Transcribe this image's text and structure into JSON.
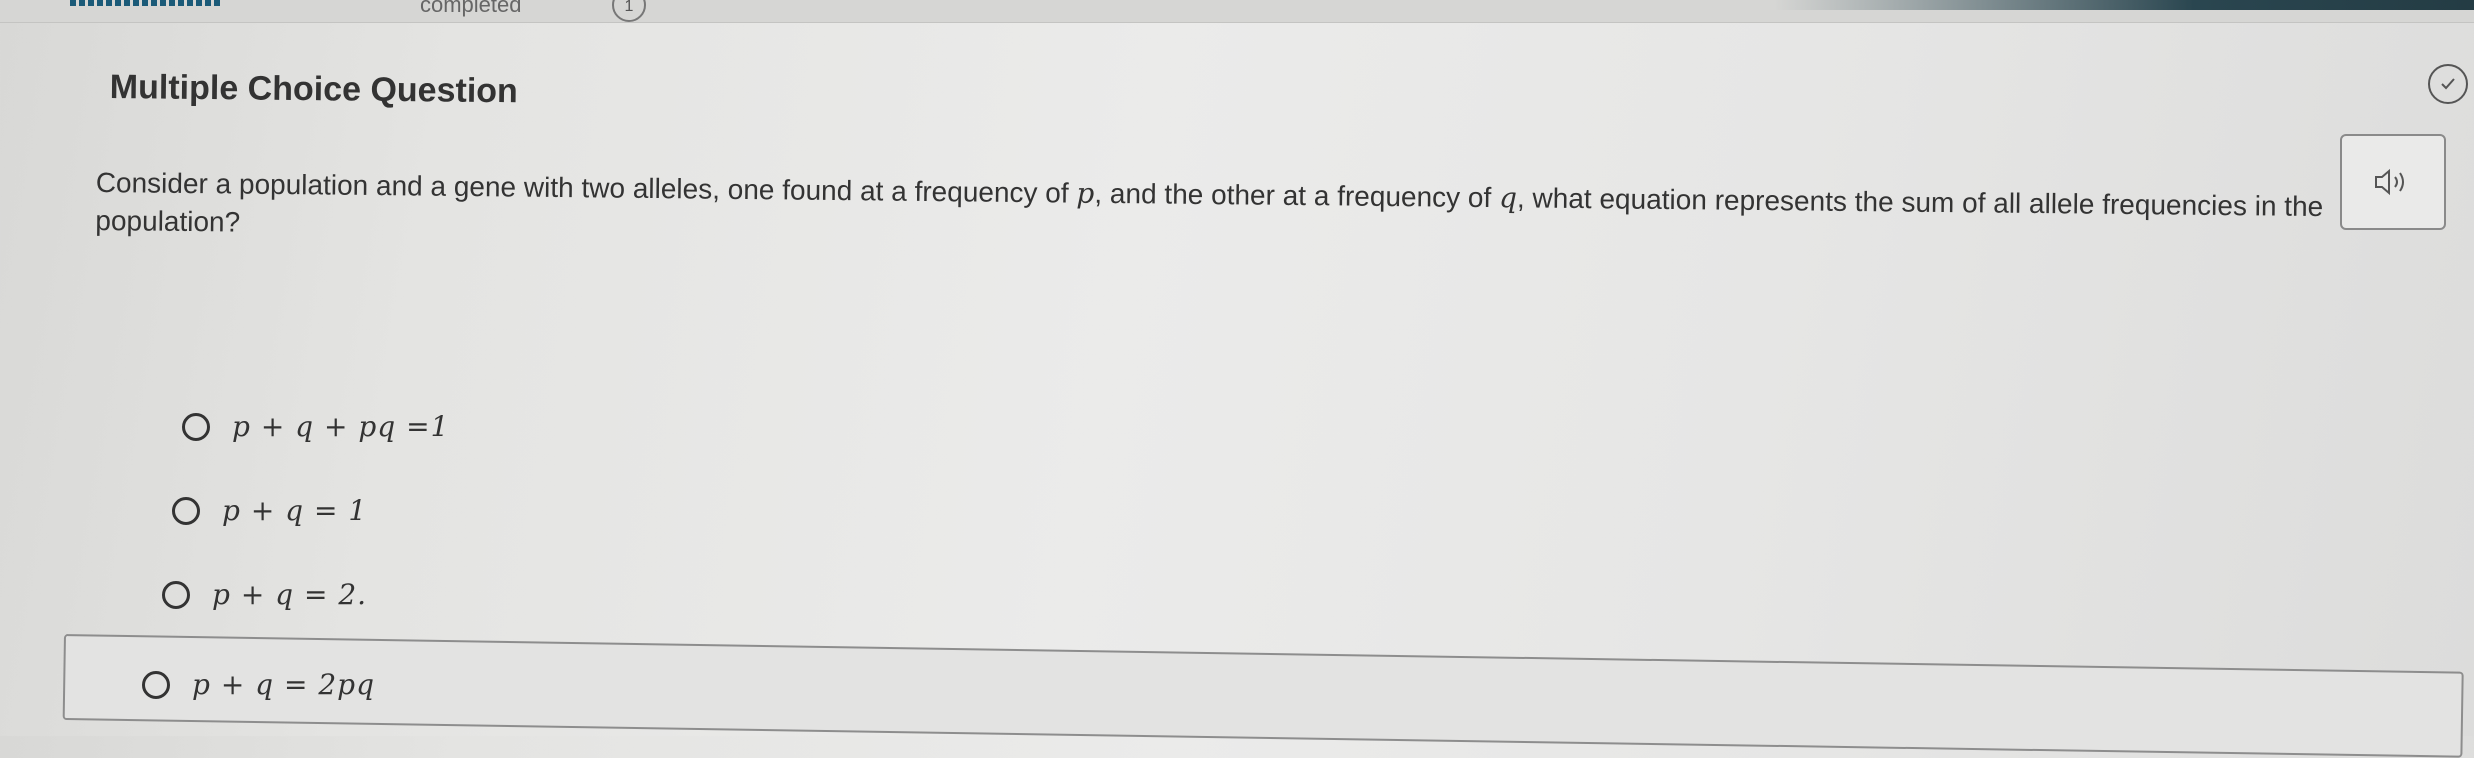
{
  "header": {
    "completed_label": "completed",
    "completed_count": "1"
  },
  "question": {
    "type_label": "Multiple Choice Question",
    "text_part1": "Consider a population and a gene with two alleles, one found at a frequency of ",
    "var_p": "p",
    "text_part2": ", and the other at a frequency of ",
    "var_q": "q",
    "text_part3": ", what equation represents the sum of all allele frequencies in the population?"
  },
  "options": [
    {
      "label": "p + q + pq =1",
      "selected": false
    },
    {
      "label": "p + q = 1",
      "selected": false
    },
    {
      "label": "p + q = 2.",
      "selected": false
    },
    {
      "label": "p + q = 2pq",
      "selected": true
    }
  ],
  "icons": {
    "audio": "speaker-icon",
    "status": "checkmark-circle-icon"
  }
}
